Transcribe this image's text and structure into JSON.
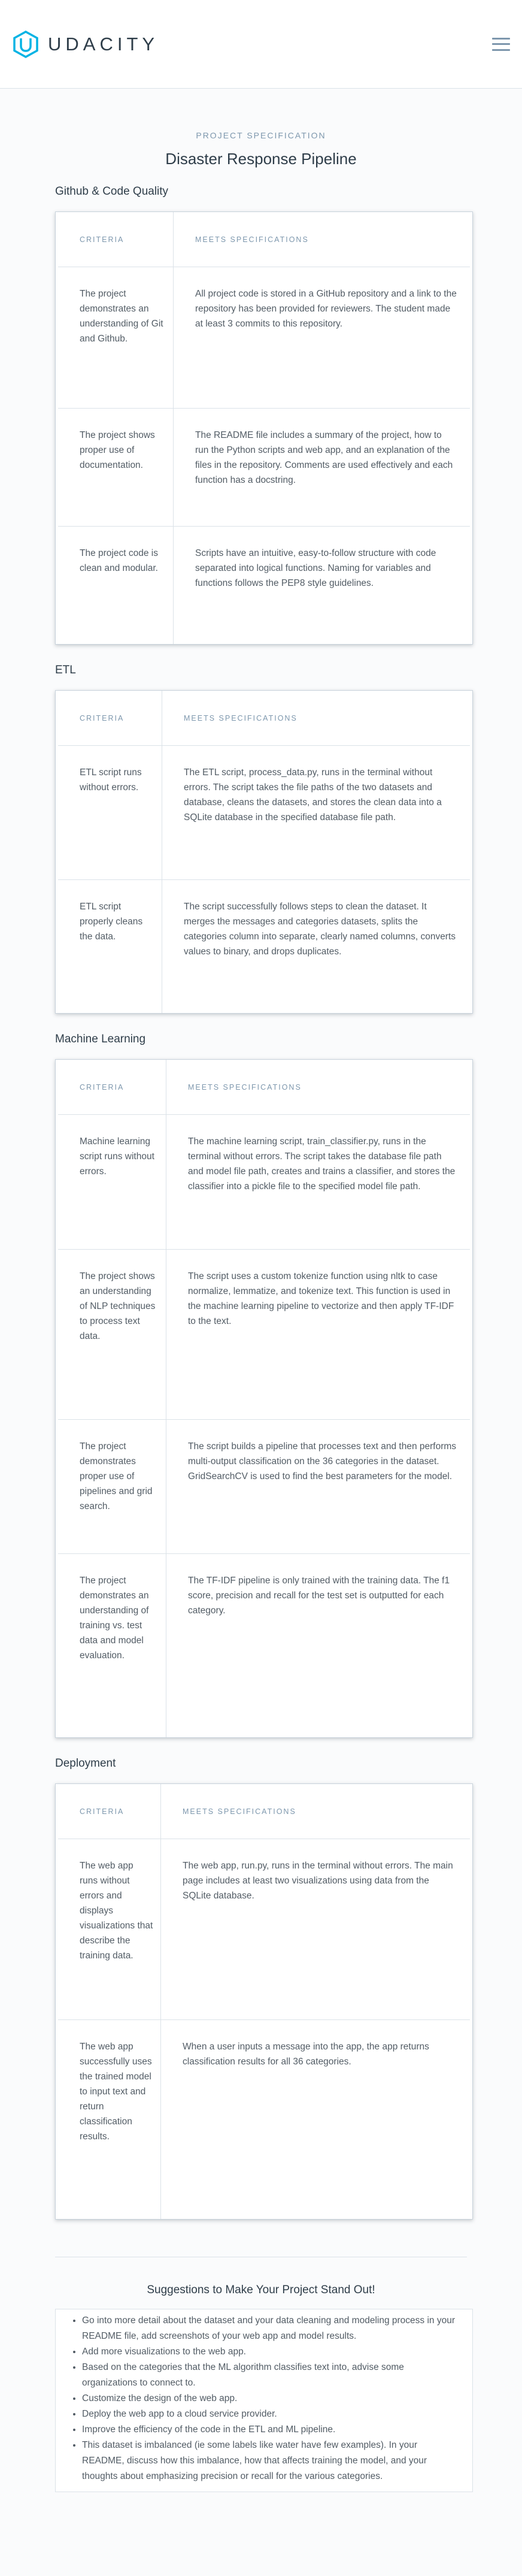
{
  "brand": {
    "name": "UDACITY"
  },
  "header": {
    "menu_icon": "hamburger-menu-icon"
  },
  "page": {
    "eyebrow": "PROJECT SPECIFICATION",
    "title": "Disaster Response Pipeline"
  },
  "table_headers": {
    "criteria": "CRITERIA",
    "meets": "MEETS SPECIFICATIONS"
  },
  "sections": [
    {
      "title": "Github & Code Quality",
      "rows": [
        {
          "criteria": "The project demonstrates an understanding of Git and Github.",
          "meets": "All project code is stored in a GitHub repository and a link to the repository has been provided for reviewers. The student made at least 3 commits to this repository."
        },
        {
          "criteria": "The project shows proper use of documentation.",
          "meets": "The README file includes a summary of the project, how to run the Python scripts and web app, and an explanation of the files in the repository. Comments are used effectively and each function has a docstring."
        },
        {
          "criteria": "The project code is clean and modular.",
          "meets": "Scripts have an intuitive, easy-to-follow structure with code separated into logical functions. Naming for variables and functions follows the PEP8 style guidelines."
        }
      ]
    },
    {
      "title": "ETL",
      "rows": [
        {
          "criteria": "ETL script runs without errors.",
          "meets": "The ETL script, process_data.py, runs in the terminal without errors. The script takes the file paths of the two datasets and database, cleans the datasets, and stores the clean data into a SQLite database in the specified database file path."
        },
        {
          "criteria": "ETL script properly cleans the data.",
          "meets": "The script successfully follows steps to clean the dataset. It merges the messages and categories datasets, splits the categories column into separate, clearly named columns, converts values to binary, and drops duplicates."
        }
      ]
    },
    {
      "title": "Machine Learning",
      "rows": [
        {
          "criteria": "Machine learning script runs without errors.",
          "meets": "The machine learning script, train_classifier.py, runs in the terminal without errors. The script takes the database file path and model file path, creates and trains a classifier, and stores the classifier into a pickle file to the specified model file path."
        },
        {
          "criteria": "The project shows an understanding of NLP techniques to process text data.",
          "meets": "The script uses a custom tokenize function using nltk to case normalize, lemmatize, and tokenize text. This function is used in the machine learning pipeline to vectorize and then apply TF-IDF to the text."
        },
        {
          "criteria": "The project demonstrates proper use of pipelines and grid search.",
          "meets": "The script builds a pipeline that processes text and then performs multi-output classification on the 36 categories in the dataset. GridSearchCV is used to find the best parameters for the model."
        },
        {
          "criteria": "The project demonstrates an understanding of training vs. test data and model evaluation.",
          "meets": "The TF-IDF pipeline is only trained with the training data. The f1 score, precision and recall for the test set is outputted for each category."
        }
      ]
    },
    {
      "title": "Deployment",
      "rows": [
        {
          "criteria": "The web app runs without errors and displays visualizations that describe the training data.",
          "meets": "The web app, run.py, runs in the terminal without errors. The main page includes at least two visualizations using data from the SQLite database."
        },
        {
          "criteria": "The web app successfully uses the trained model to input text and return classification results.",
          "meets": "When a user inputs a message into the app, the app returns classification results for all 36 categories."
        }
      ]
    }
  ],
  "suggestions": {
    "title": "Suggestions to Make Your Project Stand Out!",
    "items": [
      "Go into more detail about the dataset and your data cleaning and modeling process in your README file, add screenshots of your web app and model results.",
      "Add more visualizations to the web app.",
      "Based on the categories that the ML algorithm classifies text into, advise some organizations to connect to.",
      "Customize the design of the web app.",
      "Deploy the web app to a cloud service provider.",
      "Improve the efficiency of the code in the ETL and ML pipeline.",
      "This dataset is imbalanced (ie some labels like water have few examples). In your README, discuss how this imbalance, how that affects training the model, and your thoughts about emphasizing precision or recall for the various categories."
    ]
  },
  "colors": {
    "brand": "#02b3e4",
    "text": "#2e3d49",
    "muted": "#7d97ad",
    "body_text": "#525c65",
    "border": "#dbe2e8"
  }
}
